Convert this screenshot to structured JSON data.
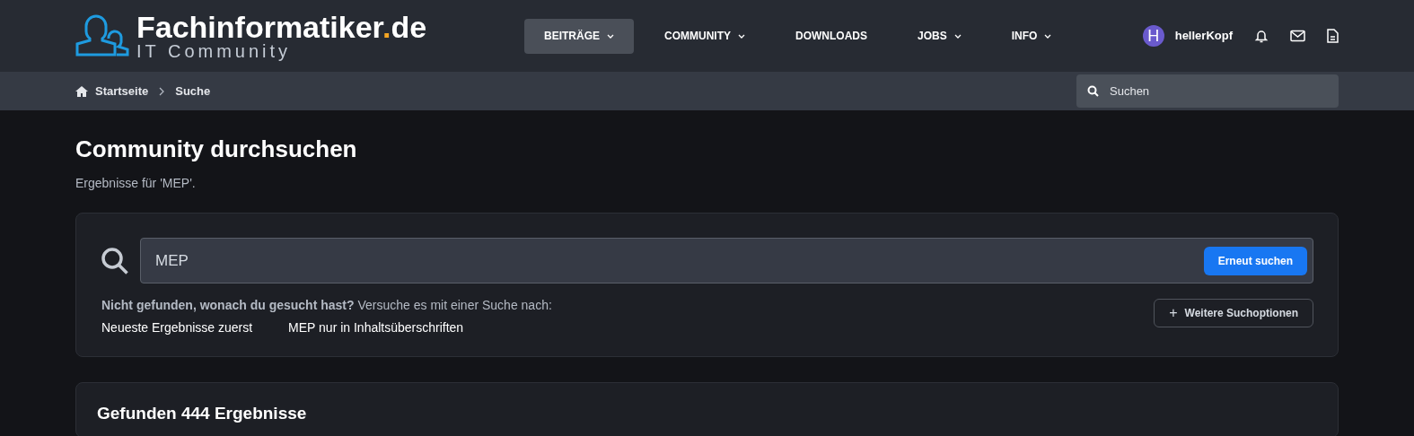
{
  "logo": {
    "name": "Fachinformatiker",
    "dot": ".",
    "tld": "de",
    "tagline": "IT Community"
  },
  "nav": [
    {
      "label": "BEITRÄGE",
      "has_menu": true,
      "selected": true
    },
    {
      "label": "COMMUNITY",
      "has_menu": true,
      "selected": false
    },
    {
      "label": "DOWNLOADS",
      "has_menu": false,
      "selected": false
    },
    {
      "label": "JOBS",
      "has_menu": true,
      "selected": false
    },
    {
      "label": "INFO",
      "has_menu": true,
      "selected": false
    }
  ],
  "user": {
    "initial": "H",
    "name": "hellerKopf"
  },
  "breadcrumb": [
    "Startseite",
    "Suche"
  ],
  "site_search": {
    "placeholder": "Suchen"
  },
  "heading": "Community durchsuchen",
  "subheading": "Ergebnisse für 'MEP'.",
  "search": {
    "value": "MEP",
    "button": "Erneut suchen"
  },
  "hint": "**Nicht gefunden, wonach du gesucht hast?** Versuche es mit einer Suche nach:",
  "suggestions": [
    "Neueste Ergebnisse zuerst",
    "MEP nur in Inhaltsüberschriften"
  ],
  "options_button": {
    "icon": "+",
    "label": "Weitere Suchoptionen"
  },
  "results_title": "Gefunden 444 Ergebnisse"
}
